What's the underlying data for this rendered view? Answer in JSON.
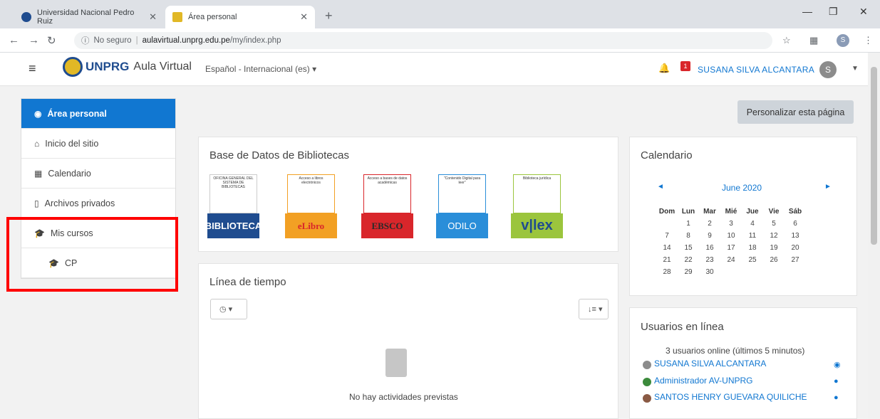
{
  "browser": {
    "tabs": [
      {
        "label": "Universidad Nacional Pedro Ruiz"
      },
      {
        "label": "Área personal"
      }
    ],
    "url_secure_text": "No seguro",
    "url_host": "aulavirtual.unprg.edu.pe",
    "url_path": "/my/index.php",
    "profile_initial": "S"
  },
  "header": {
    "brand": "UNPRG",
    "app_name": "Aula Virtual",
    "language": "Español - Internacional (es) ▾",
    "notification_count": "1",
    "user_name": "SUSANA SILVA ALCANTARA",
    "user_initial": "S"
  },
  "sidebar": {
    "items": [
      {
        "label": "Área personal"
      },
      {
        "label": "Inicio del sitio"
      },
      {
        "label": "Calendario"
      },
      {
        "label": "Archivos privados"
      },
      {
        "label": "Mis cursos"
      },
      {
        "label": "CP"
      }
    ]
  },
  "main": {
    "customize_button": "Personalizar esta página",
    "libraries": {
      "title": "Base de Datos de Bibliotecas",
      "items": [
        {
          "top_text": "OFICINA GENERAL DEL SISTEMA DE BIBLIOTECAS",
          "bottom_text": "BIBLIOTECA",
          "color": "#1f4c8f"
        },
        {
          "top_text": "Acceso a libros electrónicos",
          "bottom_text": "eLibro",
          "color": "#f2a024"
        },
        {
          "top_text": "Acceso a bases de datos académicas",
          "bottom_text": "EBSCO",
          "color": "#d9262b"
        },
        {
          "top_text": "\"Contenido Digital para leer\"",
          "bottom_text": "ODILO",
          "color": "#2a8ed9"
        },
        {
          "top_text": "Biblioteca jurídica",
          "bottom_text": "v|lex",
          "color": "#9bc53d"
        }
      ]
    },
    "timeline": {
      "title": "Línea de tiempo",
      "empty_text": "No hay actividades previstas"
    }
  },
  "calendar": {
    "title": "Calendario",
    "month": "June 2020",
    "weekdays": [
      "Dom",
      "Lun",
      "Mar",
      "Mié",
      "Jue",
      "Vie",
      "Sáb"
    ],
    "weeks": [
      [
        "",
        "1",
        "2",
        "3",
        "4",
        "5",
        "6"
      ],
      [
        "7",
        "8",
        "9",
        "10",
        "11",
        "12",
        "13"
      ],
      [
        "14",
        "15",
        "16",
        "17",
        "18",
        "19",
        "20"
      ],
      [
        "21",
        "22",
        "23",
        "24",
        "25",
        "26",
        "27"
      ],
      [
        "28",
        "29",
        "30",
        "",
        "",
        "",
        ""
      ]
    ]
  },
  "online_users": {
    "title": "Usuarios en línea",
    "summary": "3 usuarios online (últimos 5 minutos)",
    "users": [
      {
        "name": "SUSANA SILVA ALCANTARA",
        "color": "#8c8c8c"
      },
      {
        "name": "Administrador AV-UNPRG",
        "color": "#3b8a3b"
      },
      {
        "name": "SANTOS HENRY GUEVARA QUILICHE",
        "color": "#8a5a44"
      }
    ]
  }
}
